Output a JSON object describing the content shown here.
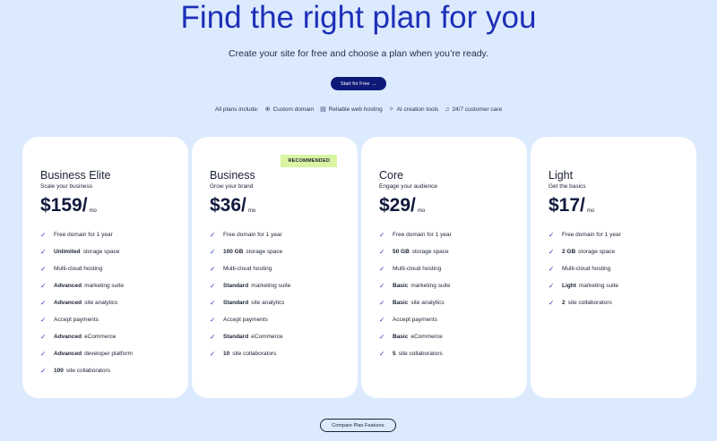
{
  "hero": {
    "title": "Find the right plan for you",
    "subtitle": "Create your site for free and choose a plan when you’re ready.",
    "start_label": "Start for Free",
    "start_arrow": "→"
  },
  "includes": {
    "label": "All plans include:",
    "items": [
      {
        "icon": "globe-icon",
        "glyph": "⊕",
        "label": "Custom domain"
      },
      {
        "icon": "server-icon",
        "glyph": "▤",
        "label": "Reliable web hosting"
      },
      {
        "icon": "sparkle-icon",
        "glyph": "✧",
        "label": "AI creation tools"
      },
      {
        "icon": "headset-icon",
        "glyph": "♫",
        "label": "24/7 customer care"
      }
    ]
  },
  "check_glyph": "✓",
  "plans": [
    {
      "name": "Business Elite",
      "tagline": "Scale your business",
      "price": "$159/",
      "per": "mo",
      "badge": "",
      "features": [
        {
          "bold": "",
          "text": "Free domain for 1 year"
        },
        {
          "bold": "Unlimited",
          "text": "storage space"
        },
        {
          "bold": "",
          "text": "Multi-cloud hosting"
        },
        {
          "bold": "Advanced",
          "text": "marketing suite"
        },
        {
          "bold": "Advanced",
          "text": "site analytics"
        },
        {
          "bold": "",
          "text": "Accept payments"
        },
        {
          "bold": "Advanced",
          "text": "eCommerce"
        },
        {
          "bold": "Advanced",
          "text": "developer platform"
        },
        {
          "bold": "100",
          "text": "site collaborators"
        }
      ]
    },
    {
      "name": "Business",
      "tagline": "Grow your brand",
      "price": "$36/",
      "per": "mo",
      "badge": "RECOMMENDED",
      "features": [
        {
          "bold": "",
          "text": "Free domain for 1 year"
        },
        {
          "bold": "100 GB",
          "text": "storage space"
        },
        {
          "bold": "",
          "text": "Multi-cloud hosting"
        },
        {
          "bold": "Standard",
          "text": "marketing suite"
        },
        {
          "bold": "Standard",
          "text": "site analytics"
        },
        {
          "bold": "",
          "text": "Accept payments"
        },
        {
          "bold": "Standard",
          "text": "eCommerce"
        },
        {
          "bold": "10",
          "text": "site collaborators"
        }
      ]
    },
    {
      "name": "Core",
      "tagline": "Engage your audience",
      "price": "$29/",
      "per": "mo",
      "badge": "",
      "features": [
        {
          "bold": "",
          "text": "Free domain for 1 year"
        },
        {
          "bold": "50 GB",
          "text": "storage space"
        },
        {
          "bold": "",
          "text": "Multi-cloud hosting"
        },
        {
          "bold": "Basic",
          "text": "marketing suite"
        },
        {
          "bold": "Basic",
          "text": "site analytics"
        },
        {
          "bold": "",
          "text": "Accept payments"
        },
        {
          "bold": "Basic",
          "text": "eCommerce"
        },
        {
          "bold": "5",
          "text": "site collaborators"
        }
      ]
    },
    {
      "name": "Light",
      "tagline": "Get the basics",
      "price": "$17/",
      "per": "mo",
      "badge": "",
      "features": [
        {
          "bold": "",
          "text": "Free domain for 1 year"
        },
        {
          "bold": "2 GB",
          "text": "storage space"
        },
        {
          "bold": "",
          "text": "Multi-cloud hosting"
        },
        {
          "bold": "Light",
          "text": "marketing suite"
        },
        {
          "bold": "2",
          "text": "site collaborators"
        }
      ]
    }
  ],
  "compare_label": "Compare Plan Features"
}
